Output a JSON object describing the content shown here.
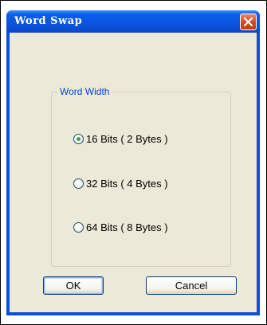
{
  "window": {
    "title": "Word Swap"
  },
  "group": {
    "label": "Word Width",
    "options": [
      {
        "label": "16 Bits ( 2 Bytes )",
        "selected": true
      },
      {
        "label": "32 Bits ( 4 Bytes )",
        "selected": false
      },
      {
        "label": "64 Bits ( 8 Bytes )",
        "selected": false
      }
    ]
  },
  "buttons": {
    "ok": "OK",
    "cancel": "Cancel"
  },
  "colors": {
    "title_bar": "#0a55df",
    "close_button": "#d2491d",
    "dialog_face": "#ece9d8",
    "group_label": "#0046d5",
    "radio_selected": "#3fa23d"
  },
  "icons": {
    "close": "close-icon"
  }
}
